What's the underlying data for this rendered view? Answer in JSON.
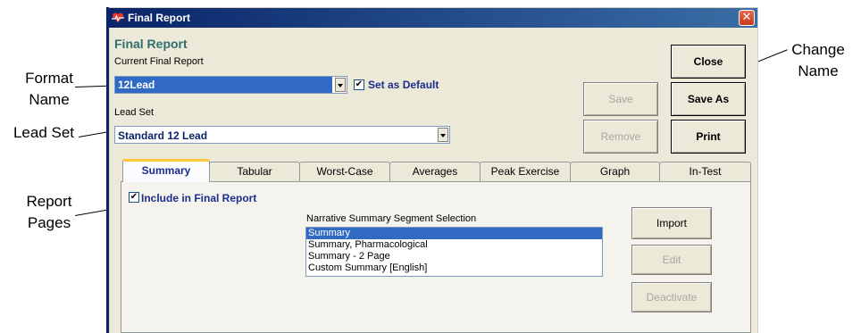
{
  "callouts": {
    "format_name": "Format\nName",
    "lead_set": "Lead Set",
    "report_pages": "Report\nPages",
    "change_name": "Change\nName"
  },
  "window": {
    "title": "Final Report",
    "close_glyph": "✕"
  },
  "header": {
    "heading": "Final Report",
    "current_label": "Current Final Report",
    "current_value": "12Lead",
    "set_default_label": "Set as Default",
    "set_default_checked": true,
    "lead_set_label": "Lead Set",
    "lead_set_value": "Standard 12 Lead"
  },
  "buttons": {
    "close": "Close",
    "save": "Save",
    "save_as": "Save As",
    "remove": "Remove",
    "print": "Print"
  },
  "tabs": [
    "Summary",
    "Tabular",
    "Worst-Case",
    "Averages",
    "Peak Exercise",
    "Graph",
    "In-Test"
  ],
  "active_tab": "Summary",
  "panel": {
    "include_label": "Include in Final Report",
    "include_checked": true,
    "list_label": "Narrative Summary Segment Selection",
    "list_items": [
      "Summary",
      "Summary, Pharmacological",
      "Summary - 2 Page",
      "Custom Summary [English]"
    ],
    "selected_index": 0,
    "import": "Import",
    "edit": "Edit",
    "deactivate": "Deactivate"
  },
  "colors": {
    "title_bar": "#0a246a",
    "heading": "#2f6f6e",
    "selection": "#316ac5",
    "active_tab_accent": "#ffc83c"
  },
  "icons": {
    "app": "heart-ecg-icon",
    "close": "close-icon",
    "checkbox": "checkmark-icon",
    "dropdown": "dropdown-arrow-icon"
  }
}
